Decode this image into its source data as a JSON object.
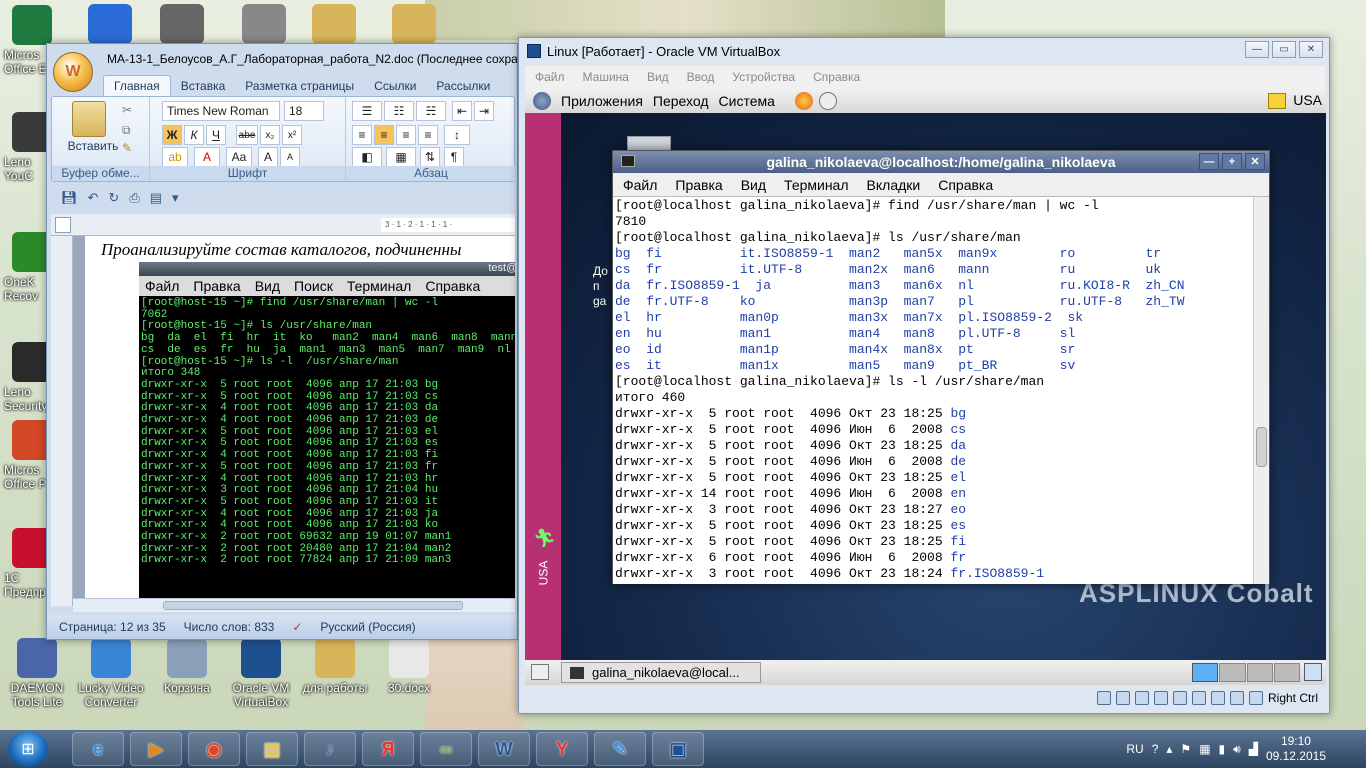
{
  "desktop": {
    "left_icons": [
      {
        "label": "Micros\nOffice E",
        "icon": "excel-icon",
        "color": "#1f7a3f"
      },
      {
        "label": "Leno\nYouC",
        "icon": "webcam-icon",
        "color": "#3a3a3a"
      },
      {
        "label": "OneK\nRecov",
        "icon": "recovery-icon",
        "color": "#2a8a2a"
      },
      {
        "label": "Leno\nSecurity",
        "icon": "security-icon",
        "color": "#2a2a2a"
      },
      {
        "label": "Micros\nOffice P",
        "icon": "powerpoint-icon",
        "color": "#d24726"
      },
      {
        "label": "1C\nПредпр",
        "icon": "1c-icon",
        "color": "#c8102e"
      }
    ],
    "bottom_icons": [
      {
        "label": "DAEMON\nTools Lite",
        "icon": "daemon-tools-icon",
        "color": "#4a66a8"
      },
      {
        "label": "Lucky Video\nConverter",
        "icon": "video-converter-icon",
        "color": "#3a84d6"
      },
      {
        "label": "Корзина",
        "icon": "recycle-bin-icon",
        "color": "#8aa0b8"
      },
      {
        "label": "Oracle VM\nVirtualBox",
        "icon": "virtualbox-icon",
        "color": "#1e4f8e"
      },
      {
        "label": "для работы",
        "icon": "folder-icon",
        "color": "#d8b45a"
      },
      {
        "label": "30.docx",
        "icon": "docx-file-icon",
        "color": "#e8e8e8"
      }
    ]
  },
  "word": {
    "title": "МА-13-1_Белоусов_А.Г_Лабораторная_работа_N2.doc (Последнее сохране",
    "tabs": [
      "Главная",
      "Вставка",
      "Разметка страницы",
      "Ссылки",
      "Рассылки"
    ],
    "paste_label": "Вставить",
    "groups": {
      "clipboard": "Буфер обме...",
      "font": "Шрифт",
      "paragraph": "Абзац"
    },
    "font_name": "Times New Roman",
    "font_size": "18",
    "ruler_marks": "3 · 1 · 2 · 1 · 1 · 1 ·",
    "heading": "Проанализируйте состав каталогов, подчиненны",
    "shot_title": "test@hos",
    "shot_menu": [
      "Файл",
      "Правка",
      "Вид",
      "Поиск",
      "Терминал",
      "Справка"
    ],
    "status": {
      "page": "Страница: 12 из 35",
      "words": "Число слов: 833",
      "lang": "Русский (Россия)"
    }
  },
  "word_shot_lines": [
    "[root@host-15 ~]# find /usr/share/man | wc -l",
    "7062",
    "[root@host-15 ~]# ls /usr/share/man",
    "bg  da  el  fi  hr  it  ko   man2  man4  man6  man8  mann",
    "cs  de  es  fr  hu  ja  man1  man3  man5  man7  man9  nl",
    "[root@host-15 ~]# ls -l  /usr/share/man",
    "итого 348",
    "drwxr-xr-x  5 root root  4096 апр 17 21:03 bg",
    "drwxr-xr-x  5 root root  4096 апр 17 21:03 cs",
    "drwxr-xr-x  4 root root  4096 апр 17 21:03 da",
    "drwxr-xr-x  4 root root  4096 апр 17 21:03 de",
    "drwxr-xr-x  5 root root  4096 апр 17 21:03 el",
    "drwxr-xr-x  5 root root  4096 апр 17 21:03 es",
    "drwxr-xr-x  4 root root  4096 апр 17 21:03 fi",
    "drwxr-xr-x  5 root root  4096 апр 17 21:03 fr",
    "drwxr-xr-x  4 root root  4096 апр 17 21:03 hr",
    "drwxr-xr-x  3 root root  4096 апр 17 21:04 hu",
    "drwxr-xr-x  5 root root  4096 апр 17 21:03 it",
    "drwxr-xr-x  4 root root  4096 апр 17 21:03 ja",
    "drwxr-xr-x  4 root root  4096 апр 17 21:03 ko",
    "drwxr-xr-x  2 root root 69632 апр 19 01:07 man1",
    "drwxr-xr-x  2 root root 20480 апр 17 21:04 man2",
    "drwxr-xr-x  2 root root 77824 апр 17 21:09 man3"
  ],
  "vbox": {
    "title": "Linux [Работает] - Oracle VM VirtualBox",
    "menu": [
      "Файл",
      "Машина",
      "Вид",
      "Ввод",
      "Устройства",
      "Справка"
    ],
    "guest_panel": [
      "Приложения",
      "Переход",
      "Система"
    ],
    "kb_layout": "USA",
    "guest_task": "galina_nikolaeva@local...",
    "host_key": "Right Ctrl",
    "side_label": "USA",
    "desk_text": "До\nп\nga",
    "brand": "ASPLINUX Cobalt"
  },
  "terminal": {
    "title": "galina_nikolaeva@localhost:/home/galina_nikolaeva",
    "menu": [
      "Файл",
      "Правка",
      "Вид",
      "Терминал",
      "Вкладки",
      "Справка"
    ],
    "lines": [
      [
        "[root@localhost galina_nikolaeva]# find /usr/share/man | wc -l",
        ""
      ],
      [
        "7810",
        ""
      ],
      [
        "[root@localhost galina_nikolaeva]# ls /usr/share/man",
        ""
      ],
      [
        "",
        "bg  fi          it.ISO8859-1  man2   man5x  man9x        ro         tr"
      ],
      [
        "",
        "cs  fr          it.UTF-8      man2x  man6   mann         ru         uk"
      ],
      [
        "",
        "da  fr.ISO8859-1  ja          man3   man6x  nl           ru.KOI8-R  zh_CN"
      ],
      [
        "",
        "de  fr.UTF-8    ko            man3p  man7   pl           ru.UTF-8   zh_TW"
      ],
      [
        "",
        "el  hr          man0p         man3x  man7x  pl.ISO8859-2  sk"
      ],
      [
        "",
        "en  hu          man1          man4   man8   pl.UTF-8     sl"
      ],
      [
        "",
        "eo  id          man1p         man4x  man8x  pt           sr"
      ],
      [
        "",
        "es  it          man1x         man5   man9   pt_BR        sv"
      ],
      [
        "[root@localhost galina_nikolaeva]# ls -l /usr/share/man",
        ""
      ],
      [
        "итого 460",
        ""
      ],
      [
        "drwxr-xr-x  5 root root  4096 Окт 23 18:25 ",
        "bg"
      ],
      [
        "drwxr-xr-x  5 root root  4096 Июн  6  2008 ",
        "cs"
      ],
      [
        "drwxr-xr-x  5 root root  4096 Окт 23 18:25 ",
        "da"
      ],
      [
        "drwxr-xr-x  5 root root  4096 Июн  6  2008 ",
        "de"
      ],
      [
        "drwxr-xr-x  5 root root  4096 Окт 23 18:25 ",
        "el"
      ],
      [
        "drwxr-xr-x 14 root root  4096 Июн  6  2008 ",
        "en"
      ],
      [
        "drwxr-xr-x  3 root root  4096 Окт 23 18:27 ",
        "eo"
      ],
      [
        "drwxr-xr-x  5 root root  4096 Окт 23 18:25 ",
        "es"
      ],
      [
        "drwxr-xr-x  5 root root  4096 Окт 23 18:25 ",
        "fi"
      ],
      [
        "drwxr-xr-x  6 root root  4096 Июн  6  2008 ",
        "fr"
      ],
      [
        "drwxr-xr-x  3 root root  4096 Окт 23 18:24 ",
        "fr.ISO8859-1"
      ]
    ]
  },
  "taskbar": {
    "apps": [
      {
        "name": "ie",
        "glyph": "e",
        "icon": "internet-explorer-icon",
        "color": "#2f8fe6"
      },
      {
        "name": "media",
        "glyph": "▶",
        "icon": "media-player-icon",
        "color": "#e08a1e"
      },
      {
        "name": "chrome",
        "glyph": "◉",
        "icon": "chrome-icon",
        "color": "#d64a2a"
      },
      {
        "name": "explorer",
        "glyph": "▤",
        "icon": "file-explorer-icon",
        "color": "#e2c15a"
      },
      {
        "name": "sound",
        "glyph": "♪",
        "icon": "sound-app-icon",
        "color": "#3a6fb8"
      },
      {
        "name": "yandex",
        "glyph": "Я",
        "icon": "yandex-icon",
        "color": "#e32"
      },
      {
        "name": "linker",
        "glyph": "∞",
        "icon": "chain-app-icon",
        "color": "#6aa84f"
      },
      {
        "name": "word",
        "glyph": "W",
        "icon": "word-icon",
        "color": "#2b579a"
      },
      {
        "name": "yabrowser",
        "glyph": "Y",
        "icon": "yandex-browser-icon",
        "color": "#e33"
      },
      {
        "name": "paint",
        "glyph": "✎",
        "icon": "paint-icon",
        "color": "#4a90d9"
      },
      {
        "name": "vbox",
        "glyph": "▣",
        "icon": "virtualbox-task-icon",
        "color": "#1e4f8e"
      }
    ],
    "lang": "RU",
    "time": "19:10",
    "date": "09.12.2015"
  }
}
